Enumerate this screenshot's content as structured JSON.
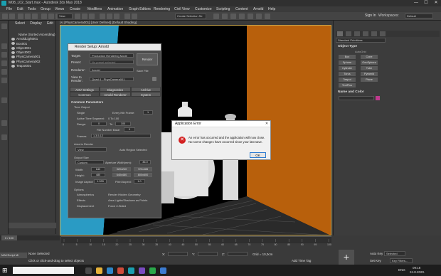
{
  "window": {
    "title": "M08_L02_Start.max - Autodesk 3ds Max 2018",
    "controls": {
      "minimize": "—",
      "maximize": "☐",
      "close": "✕"
    }
  },
  "menu": [
    "File",
    "Edit",
    "Tools",
    "Group",
    "Views",
    "Create",
    "Modifiers",
    "Animation",
    "Graph Editors",
    "Rendering",
    "Civil View",
    "Customize",
    "Scripting",
    "Content",
    "Arnold",
    "Help"
  ],
  "toolbar": {
    "view_dropdown": "View",
    "selection_set": "Create Selection Se",
    "signin": "Sign In",
    "workspace_label": "Workspaces:",
    "workspace_value": "Default"
  },
  "scene_explorer": {
    "tabs": [
      "Select",
      "Display",
      "Edit"
    ],
    "header": "Name (Sorted Ascending)",
    "items": [
      "ArnoldLight001",
      "Box001",
      "Object001",
      "Object002",
      "PhysCamera001",
      "PhysCamera002",
      "Teapot001"
    ]
  },
  "viewport": {
    "label": "[+] [PhysCamera001] [User Defined] [Default Shading]"
  },
  "render_setup": {
    "title": "Render Setup: Arnold",
    "target_label": "Target:",
    "target_value": "Production Rendering Mode",
    "preset_label": "Preset:",
    "preset_value": "No preset selected",
    "renderer_label": "Renderer:",
    "renderer_value": "Arnold",
    "save_file": "Save File",
    "view_label": "View to Render:",
    "view_value": "Quad 4 - PhysCamera001",
    "render_button": "Render",
    "tabs_row1": [
      "AOV Settings",
      "Diagnostics",
      "Archive"
    ],
    "tabs_row2": [
      "Common",
      "Arnold Renderer",
      "System"
    ],
    "section_common": "Common Parameters",
    "time_output": "Time Output",
    "single": "Single",
    "every_nth": "Every Nth Frame:",
    "every_nth_value": "1",
    "active_segment": "Active Time Segment:",
    "active_segment_value": "0 To 100",
    "range": "Range:",
    "range_from": "0",
    "range_to_label": "To",
    "range_to": "100",
    "file_number_base": "File Number Base:",
    "file_number_value": "0",
    "frames": "Frames",
    "frames_value": "1,3,5-12",
    "area_to_render": "Area to Render",
    "area_value": "View",
    "auto_region": "Auto Region Selected",
    "output_size": "Output Size",
    "output_custom": "Custom",
    "aperture_label": "Aperture Width(mm):",
    "aperture_value": "36.0",
    "width_label": "Width:",
    "width_value": "640",
    "height_label": "Height:",
    "height_value": "480",
    "presets": [
      "320x240",
      "720x486",
      "640x480",
      "800x600"
    ],
    "image_aspect_label": "Image Aspect:",
    "image_aspect_value": "1.333",
    "pixel_aspect_label": "Pixel Aspect:",
    "pixel_aspect_value": "1.0",
    "options": "Options",
    "opt_atmospherics": "Atmospherics",
    "opt_render_hidden": "Render Hidden Geometry",
    "opt_effects": "Effects",
    "opt_area_lights": "Area Lights/Shadows as Points",
    "opt_displacement": "Displacement",
    "opt_force_2sided": "Force 2-Sided"
  },
  "error_dialog": {
    "title": "Application Error",
    "message": "An error has occurred and the application will now close. No scene changes have occurred since your last save.",
    "ok": "OK",
    "close": "✕"
  },
  "command_panel": {
    "dropdown": "Standard Primitives",
    "object_type": "Object Type",
    "autogrid": "AutoGrid",
    "buttons": [
      "Box",
      "Cone",
      "Sphere",
      "GeoSphere",
      "Cylinder",
      "Tube",
      "Torus",
      "Pyramid",
      "Teapot",
      "Plane",
      "TextPlus"
    ],
    "name_and_color": "Name and Color"
  },
  "timeline": {
    "frame_display": "0 / 100",
    "ticks": [
      "0",
      "5",
      "10",
      "15",
      "20",
      "25",
      "30",
      "35",
      "40",
      "45",
      "50",
      "55",
      "60",
      "65",
      "70",
      "75",
      "80",
      "85",
      "90",
      "95",
      "100"
    ]
  },
  "status": {
    "selection": "None Selected",
    "prompt": "Click or click-and-drag to select objects",
    "maxscript": "MAXScript Mi",
    "x_label": "X:",
    "y_label": "Y:",
    "z_label": "Z:",
    "grid": "Grid = 10,0cm",
    "add_time_tag": "Add Time Tag",
    "auto_key": "Auto Key",
    "set_key": "Set Key",
    "selected": "Selected",
    "key_filters": "Key Filters..."
  },
  "taskbar": {
    "time": "09:18",
    "date": "24.8.2020.",
    "lang": "ENG"
  },
  "colors": {
    "accent": "#c0a040",
    "error_red": "#d32020",
    "wall_orange": "#b8600c",
    "wall_blue": "#2a9bc4"
  }
}
